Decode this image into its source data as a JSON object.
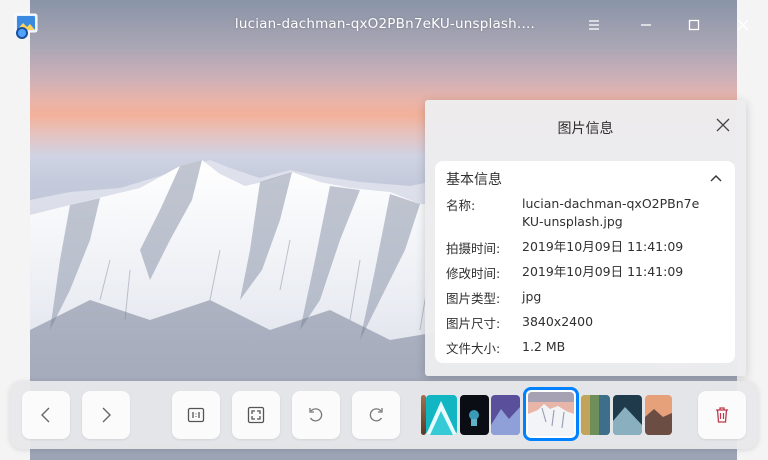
{
  "window": {
    "title": "lucian-dachman-qxO2PBn7eKU-unsplash.…"
  },
  "icons": {
    "app": "image-viewer-app-icon",
    "menu": "menu-icon",
    "minimize": "minimize-icon",
    "maximize": "maximize-icon",
    "close": "close-icon"
  },
  "info_panel": {
    "title": "图片信息",
    "section_title": "基本信息",
    "rows": [
      {
        "key": "名称:",
        "value": "lucian-dachman-qxO2PBn7eKU-unsplash.jpg"
      },
      {
        "key": "拍摄时间:",
        "value": "2019年10月09日 11:41:09"
      },
      {
        "key": "修改时间:",
        "value": "2019年10月09日 11:41:09"
      },
      {
        "key": "图片类型:",
        "value": "jpg"
      },
      {
        "key": "图片尺寸:",
        "value": "3840x2400"
      },
      {
        "key": "文件大小:",
        "value": "1.2 MB"
      }
    ]
  },
  "toolbar": {
    "buttons": [
      "previous",
      "next",
      "original-size",
      "fit-window",
      "rotate-left",
      "rotate-right",
      "delete"
    ],
    "thumbnails": [
      "partial-edge",
      "teal-shapes",
      "astronaut",
      "purple-mountain",
      "snow-mountain-current",
      "green-landscape",
      "dark-landscape",
      "sunset-rocks"
    ],
    "selected_thumbnail": "snow-mountain-current"
  },
  "colors": {
    "accent": "#0081ff",
    "delete": "#c0364a",
    "panel_bg": "#ececee",
    "card_bg": "#ffffff"
  }
}
